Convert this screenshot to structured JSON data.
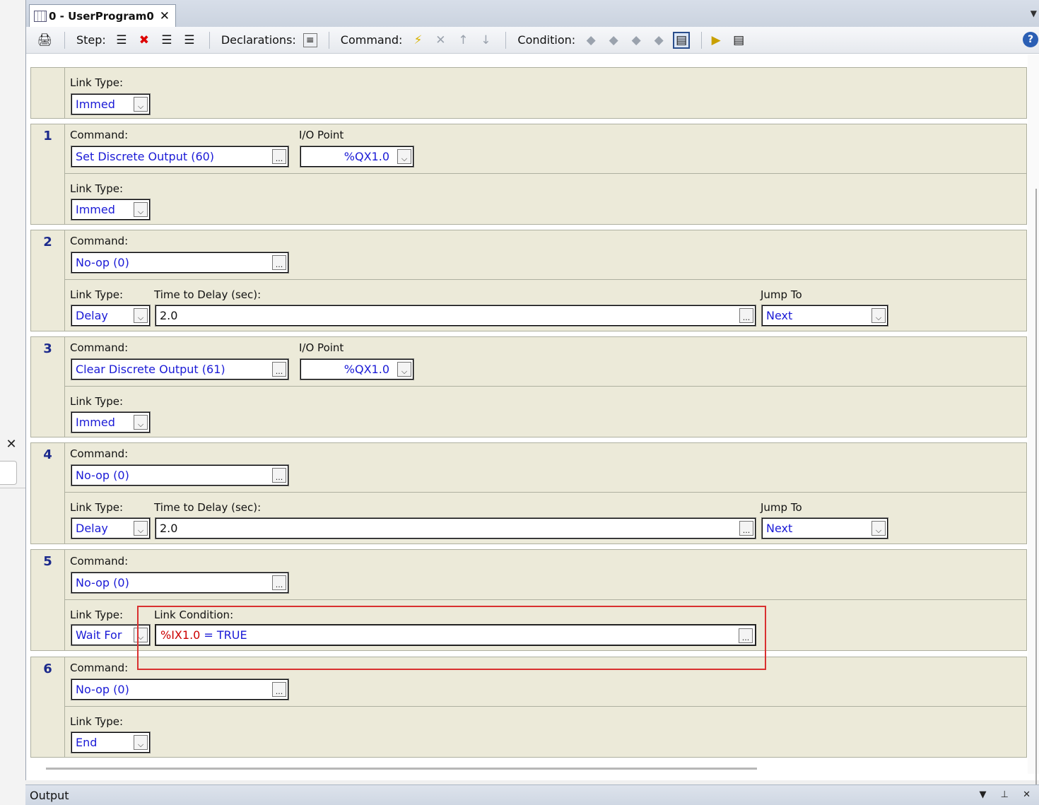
{
  "tab": {
    "title": "0 - UserProgram0",
    "close": "✕"
  },
  "toolbar": {
    "step_label": "Step:",
    "declarations_label": "Declarations:",
    "command_label": "Command:",
    "condition_label": "Condition:"
  },
  "steps": [
    {
      "number": "",
      "link_type_label": "Link Type:",
      "link_type": "Immed"
    },
    {
      "number": "1",
      "command_label": "Command:",
      "command": "Set Discrete Output (60)",
      "io_label": "I/O Point",
      "io_point": "%QX1.0",
      "link_type_label": "Link Type:",
      "link_type": "Immed"
    },
    {
      "number": "2",
      "command_label": "Command:",
      "command": "No-op (0)",
      "link_type_label": "Link Type:",
      "link_type": "Delay",
      "delay_label": "Time to Delay (sec):",
      "delay": "2.0",
      "jump_label": "Jump To",
      "jump": "Next"
    },
    {
      "number": "3",
      "command_label": "Command:",
      "command": "Clear Discrete Output (61)",
      "io_label": "I/O Point",
      "io_point": "%QX1.0",
      "link_type_label": "Link Type:",
      "link_type": "Immed"
    },
    {
      "number": "4",
      "command_label": "Command:",
      "command": "No-op (0)",
      "link_type_label": "Link Type:",
      "link_type": "Delay",
      "delay_label": "Time to Delay (sec):",
      "delay": "2.0",
      "jump_label": "Jump To",
      "jump": "Next"
    },
    {
      "number": "5",
      "command_label": "Command:",
      "command": "No-op (0)",
      "link_type_label": "Link Type:",
      "link_type": "Wait For",
      "condition_label": "Link Condition:",
      "condition_var": "%IX1.0",
      "condition_rest": " = TRUE"
    },
    {
      "number": "6",
      "command_label": "Command:",
      "command": "No-op (0)",
      "link_type_label": "Link Type:",
      "link_type": "End"
    }
  ],
  "ellipsis": "...",
  "output_panel": {
    "title": "Output"
  },
  "left_panel": {
    "close": "✕"
  }
}
